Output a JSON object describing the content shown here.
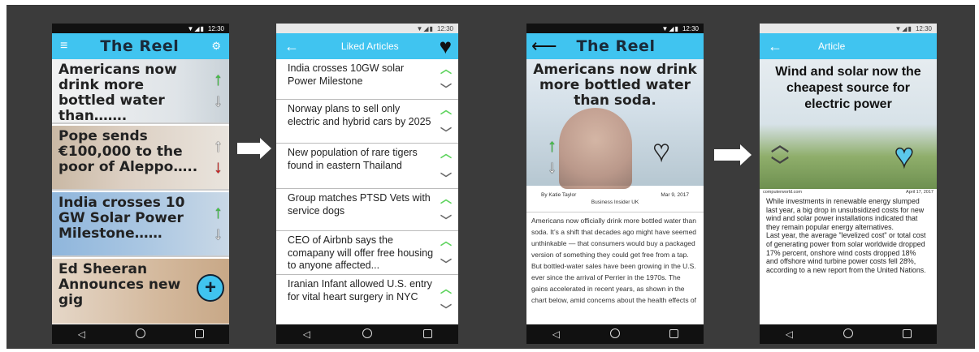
{
  "status": {
    "time": "12:30",
    "icons": "▼◢▮"
  },
  "nav": {
    "back": "◁",
    "home": "○",
    "recent": "□"
  },
  "screen1": {
    "title": "The Reel",
    "menu_icon": "≡",
    "filter_icon": "⚙",
    "fab_icon": "+",
    "cards": [
      {
        "headline": "Americans now drink more bottled water than……."
      },
      {
        "headline": "Pope sends €100,000 to the poor of Aleppo….."
      },
      {
        "headline": "India crosses 10 GW Solar Power Milestone……"
      },
      {
        "headline": "Ed Sheeran Announces new gig"
      }
    ]
  },
  "screen2": {
    "title": "Liked Articles",
    "items": [
      {
        "text": "India crosses 10GW solar Power Milestone"
      },
      {
        "text": "Norway plans to sell only electric and hybrid cars by 2025"
      },
      {
        "text": "New population of rare tigers found in eastern Thailand"
      },
      {
        "text": "Group matches PTSD Vets with service dogs"
      },
      {
        "text": "CEO of Airbnb says the comapany will offer free housing to anyone affected..."
      },
      {
        "text": "Iranian Infant allowed U.S. entry for vital heart surgery in NYC"
      }
    ]
  },
  "screen3": {
    "title": "The Reel",
    "headline": "Americans now drink more bottled water than soda.",
    "author": "By Katie Taylor",
    "date": "Mar 9, 2017",
    "source": "Business Insider UK",
    "body": "Americans now officially drink more bottled water than soda. It’s a shift that decades ago might have seemed unthinkable — that consumers would buy a packaged version of something they could get free from a tap. But bottled-water sales have been growing in the U.S. ever since the arrival of Perrier in the 1970s. The gains accelerated in recent years, as shown in the chart below, amid concerns about the health effects of"
  },
  "screen4": {
    "title": "Article",
    "headline": "Wind and solar now the cheapest source for electric power",
    "source": "computerworld.com",
    "date": "April 17, 2017",
    "body": "While investments in renewable energy slumped last year, a big drop in unsubsidized costs for new wind and solar power installations indicated that they remain popular energy alternatives.\nLast year, the average \"levelized cost\" or total cost of generating power from solar worldwide dropped 17% percent, onshore wind costs dropped 18% and offshore wind turbine power costs fell 28%, according to a new report from the United Nations."
  },
  "colors": {
    "appbar": "#40c4f0",
    "upvote": "#3fcf3f",
    "downvote": "#d22020",
    "liked_heart": "#5bc8ea"
  }
}
